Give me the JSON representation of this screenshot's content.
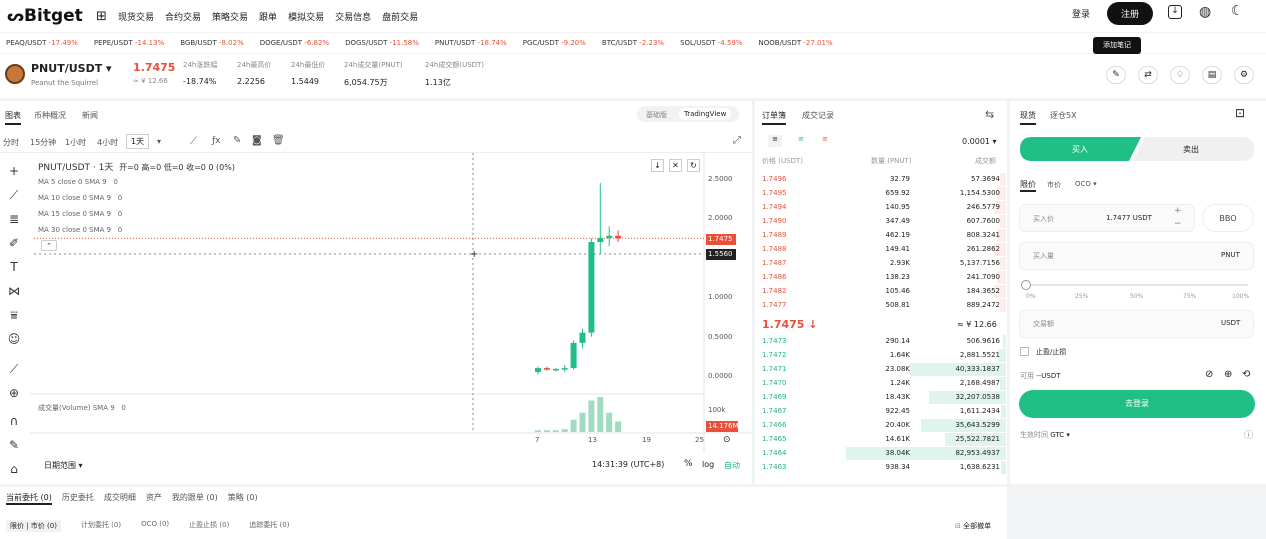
{
  "header": {
    "logo": "Bitget",
    "nav": [
      "现货交易",
      "合约交易",
      "策略交易",
      "跟单",
      "模拟交易",
      "交易信息",
      "盘前交易"
    ],
    "login": "登录",
    "register": "注册",
    "tooltip": "添加笔记"
  },
  "ticker": [
    {
      "sym": "PEAQ/USDT",
      "chg": "-17.49%"
    },
    {
      "sym": "PEPE/USDT",
      "chg": "-14.13%"
    },
    {
      "sym": "BGB/USDT",
      "chg": "-8.02%"
    },
    {
      "sym": "DOGE/USDT",
      "chg": "-6.82%"
    },
    {
      "sym": "DOGS/USDT",
      "chg": "-11.58%"
    },
    {
      "sym": "PNUT/USDT",
      "chg": "-18.74%"
    },
    {
      "sym": "PGC/USDT",
      "chg": "-9.20%"
    },
    {
      "sym": "BTC/USDT",
      "chg": "-2.23%"
    },
    {
      "sym": "SOL/USDT",
      "chg": "-4.59%"
    },
    {
      "sym": "NOOB/USDT",
      "chg": "-27.01%"
    }
  ],
  "pair": {
    "symbol": "PNUT/USDT",
    "name": "Peanut the Squirrel",
    "price": "1.7475",
    "cny": "≈ ¥ 12.66",
    "stats": [
      {
        "label": "24h涨跌幅",
        "value": "-18.74%"
      },
      {
        "label": "24h最高价",
        "value": "2.2256"
      },
      {
        "label": "24h最低价",
        "value": "1.5449"
      },
      {
        "label": "24h成交量(PNUT)",
        "value": "6,054.75万"
      },
      {
        "label": "24h成交额(USDT)",
        "value": "1.13亿"
      }
    ]
  },
  "chart": {
    "tabs": [
      "图表",
      "币种概况",
      "新闻"
    ],
    "view_tabs": [
      "基础版",
      "TradingView"
    ],
    "intervals": [
      "分时",
      "15分钟",
      "1小时",
      "4小时",
      "1天"
    ],
    "legend_title": "PNUT/USDT · 1天",
    "ohlc": "开=0 高=0 低=0 收=0 0 (0%)",
    "ma": [
      "MA 5 close 0 SMA 9",
      "MA 10 close 0 SMA 9",
      "MA 15 close 0 SMA 9",
      "MA 30 close 0 SMA 9"
    ],
    "ma_val": "0",
    "y_labels": [
      "2.5000",
      "2.0000",
      "1.5000",
      "1.0000",
      "0.5000",
      "0.0000"
    ],
    "price_tag": "1.7475",
    "cross_tag": "1.5560",
    "volume_label": "成交量(Volume) SMA 9",
    "volume_val": "0",
    "vol_axis": "100k",
    "vol_tag": "14.176M",
    "x_labels": [
      "7",
      "13",
      "19",
      "25"
    ],
    "date_range": "日期范围",
    "time": "14:31:39 (UTC+8)",
    "pct": "%",
    "log": "log",
    "auto": "自动"
  },
  "chart_data": {
    "type": "candlestick",
    "x_ticks": [
      "7",
      "13",
      "19",
      "25"
    ],
    "ylim": [
      0,
      2.5
    ],
    "candles": [
      {
        "o": 0.05,
        "h": 0.12,
        "l": 0.02,
        "c": 0.1
      },
      {
        "o": 0.1,
        "h": 0.12,
        "l": 0.07,
        "c": 0.08
      },
      {
        "o": 0.08,
        "h": 0.1,
        "l": 0.06,
        "c": 0.09
      },
      {
        "o": 0.09,
        "h": 0.14,
        "l": 0.05,
        "c": 0.1
      },
      {
        "o": 0.1,
        "h": 0.45,
        "l": 0.08,
        "c": 0.42
      },
      {
        "o": 0.42,
        "h": 0.6,
        "l": 0.35,
        "c": 0.55
      },
      {
        "o": 0.55,
        "h": 1.75,
        "l": 0.5,
        "c": 1.7
      },
      {
        "o": 1.7,
        "h": 2.45,
        "l": 1.55,
        "c": 1.75
      },
      {
        "o": 1.75,
        "h": 1.9,
        "l": 1.65,
        "c": 1.78
      },
      {
        "o": 1.78,
        "h": 1.85,
        "l": 1.7,
        "c": 1.7475
      }
    ],
    "volume": [
      0.05,
      0.05,
      0.05,
      0.08,
      0.35,
      0.55,
      0.9,
      1.0,
      0.55,
      0.3
    ]
  },
  "orderbook": {
    "tabs": [
      "订单簿",
      "成交记录"
    ],
    "precision": "0.0001",
    "headers": [
      "价格 (USDT)",
      "数量 (PNUT)",
      "成交额"
    ],
    "asks": [
      [
        "1.7496",
        "32.79",
        "57.3694"
      ],
      [
        "1.7495",
        "659.92",
        "1,154.5300"
      ],
      [
        "1.7494",
        "140.95",
        "246.5779"
      ],
      [
        "1.7490",
        "347.49",
        "607.7600"
      ],
      [
        "1.7489",
        "462.19",
        "808.3241"
      ],
      [
        "1.7488",
        "149.41",
        "261.2862"
      ],
      [
        "1.7487",
        "2.93K",
        "5,137.7156"
      ],
      [
        "1.7486",
        "138.23",
        "241.7090"
      ],
      [
        "1.7482",
        "105.46",
        "184.3652"
      ],
      [
        "1.7477",
        "508.81",
        "889.2472"
      ]
    ],
    "mid_price": "1.7475 ↓",
    "mid_cny": "≈ ¥ 12.66",
    "bids": [
      [
        "1.7473",
        "290.14",
        "506.9616"
      ],
      [
        "1.7472",
        "1.64K",
        "2,881.5521"
      ],
      [
        "1.7471",
        "23.08K",
        "40,333.1837"
      ],
      [
        "1.7470",
        "1.24K",
        "2,168.4987"
      ],
      [
        "1.7469",
        "18.43K",
        "32,207.0538"
      ],
      [
        "1.7467",
        "922.45",
        "1,611.2434"
      ],
      [
        "1.7466",
        "20.40K",
        "35,643.5299"
      ],
      [
        "1.7465",
        "14.61K",
        "25,522.7821"
      ],
      [
        "1.7464",
        "38.04K",
        "82,953.4937"
      ],
      [
        "1.7463",
        "938.34",
        "1,638.6231"
      ]
    ],
    "bid_depth": [
      0.02,
      0.05,
      0.6,
      0.04,
      0.48,
      0.03,
      0.53,
      0.38,
      1.0,
      0.03
    ]
  },
  "trade": {
    "tabs": [
      "现货",
      "逐仓5X"
    ],
    "buy": "买入",
    "sell": "卖出",
    "types": [
      "限价",
      "市价",
      "OCO ▾"
    ],
    "price_label": "买入价",
    "price_value": "1.7477 USDT",
    "bbo": "BBO",
    "qty_label": "买入量",
    "qty_unit": "PNUT",
    "pcts": [
      "0%",
      "25%",
      "50%",
      "75%",
      "100%"
    ],
    "amount_label": "交易额",
    "amount_unit": "USDT",
    "tpsl": "止盈/止损",
    "avail_label": "可用",
    "avail_value": "--USDT",
    "login_btn": "去登录",
    "tif_label": "生效时间",
    "tif_value": "GTC ▾"
  },
  "bottom": {
    "tabs": [
      "当前委托 (0)",
      "历史委托",
      "成交明细",
      "资产",
      "我的跟单 (0)",
      "策略 (0)"
    ],
    "subtabs": [
      "限价 | 市价 (0)",
      "计划委托 (0)",
      "OCO (0)",
      "止盈止损 (0)",
      "追踪委托 (0)"
    ],
    "cancel_all": "全部撤单"
  }
}
